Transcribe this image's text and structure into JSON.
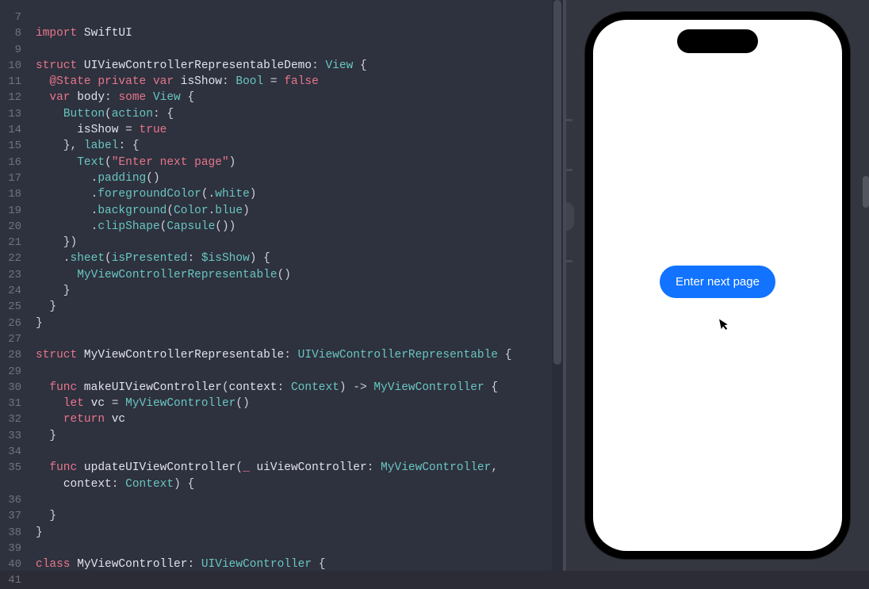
{
  "editor": {
    "startLine": 7,
    "lines": [
      {
        "n": 7,
        "html": ""
      },
      {
        "n": 8,
        "html": "<span class='kw-pink'>import</span> <span class='kw-white'>SwiftUI</span>"
      },
      {
        "n": 9,
        "html": ""
      },
      {
        "n": 10,
        "html": "<span class='kw-pink'>struct</span> <span class='kw-white'>UIViewControllerRepresentableDemo</span>: <span class='kw-teal'>View</span> {"
      },
      {
        "n": 11,
        "html": "  <span class='kw-pink'>@State</span> <span class='kw-pink'>private</span> <span class='kw-pink'>var</span> <span class='kw-white'>isShow</span>: <span class='kw-teal'>Bool</span> = <span class='kw-pink'>false</span>"
      },
      {
        "n": 12,
        "html": "  <span class='kw-pink'>var</span> <span class='kw-white'>body</span>: <span class='kw-pink'>some</span> <span class='kw-teal'>View</span> {"
      },
      {
        "n": 13,
        "html": "    <span class='kw-teal'>Button</span>(<span class='kw-teal'>action</span>: {"
      },
      {
        "n": 14,
        "html": "      <span class='kw-white'>isShow</span> = <span class='kw-pink'>true</span>"
      },
      {
        "n": 15,
        "html": "    }, <span class='kw-teal'>label</span>: {"
      },
      {
        "n": 16,
        "html": "      <span class='kw-teal'>Text</span>(<span class='kw-str'>\"Enter next page\"</span>)"
      },
      {
        "n": 17,
        "html": "        .<span class='kw-teal'>padding</span>()"
      },
      {
        "n": 18,
        "html": "        .<span class='kw-teal'>foregroundColor</span>(.<span class='kw-teal'>white</span>)"
      },
      {
        "n": 19,
        "html": "        .<span class='kw-teal'>background</span>(<span class='kw-teal'>Color</span>.<span class='kw-teal'>blue</span>)"
      },
      {
        "n": 20,
        "html": "        .<span class='kw-teal'>clipShape</span>(<span class='kw-teal'>Capsule</span>())"
      },
      {
        "n": 21,
        "html": "    })"
      },
      {
        "n": 22,
        "html": "    .<span class='kw-teal'>sheet</span>(<span class='kw-teal'>isPresented</span>: <span class='kw-teal'>$isShow</span>) {"
      },
      {
        "n": 23,
        "html": "      <span class='kw-teal'>MyViewControllerRepresentable</span>()"
      },
      {
        "n": 24,
        "html": "    }"
      },
      {
        "n": 25,
        "html": "  }"
      },
      {
        "n": 26,
        "html": "}"
      },
      {
        "n": 27,
        "html": ""
      },
      {
        "n": 28,
        "html": "<span class='kw-pink'>struct</span> <span class='kw-white'>MyViewControllerRepresentable</span>: <span class='kw-teal'>UIViewControllerRepresentable</span> {"
      },
      {
        "n": 29,
        "html": ""
      },
      {
        "n": 30,
        "html": "  <span class='kw-pink'>func</span> <span class='kw-white'>makeUIViewController</span>(<span class='kw-white'>context</span>: <span class='kw-teal'>Context</span>) -> <span class='kw-teal'>MyViewController</span> {"
      },
      {
        "n": 31,
        "html": "    <span class='kw-pink'>let</span> <span class='kw-white'>vc</span> = <span class='kw-teal'>MyViewController</span>()"
      },
      {
        "n": 32,
        "html": "    <span class='kw-pink'>return</span> <span class='kw-white'>vc</span>"
      },
      {
        "n": 33,
        "html": "  }"
      },
      {
        "n": 34,
        "html": ""
      },
      {
        "n": 35,
        "html": "  <span class='kw-pink'>func</span> <span class='kw-white'>updateUIViewController</span>(<span class='kw-pink'>_</span> <span class='kw-white'>uiViewController</span>: <span class='kw-teal'>MyViewController</span>,"
      },
      {
        "n": "",
        "html": "    <span class='kw-white'>context</span>: <span class='kw-teal'>Context</span>) {"
      },
      {
        "n": 36,
        "html": ""
      },
      {
        "n": 37,
        "html": "  }"
      },
      {
        "n": 38,
        "html": "}"
      },
      {
        "n": 39,
        "html": ""
      },
      {
        "n": 40,
        "html": "<span class='kw-pink'>class</span> <span class='kw-white'>MyViewController</span>: <span class='kw-teal'>UIViewController</span> {"
      },
      {
        "n": 41,
        "html": ""
      }
    ]
  },
  "preview": {
    "buttonLabel": "Enter next page"
  }
}
